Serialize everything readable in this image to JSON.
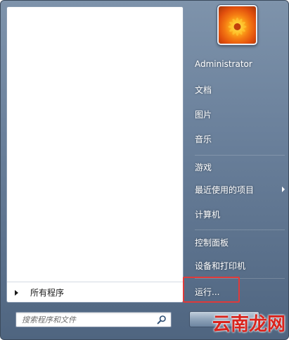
{
  "left_pane": {
    "all_programs_label": "所有程序",
    "search": {
      "placeholder": "搜索程序和文件"
    }
  },
  "right_pane": {
    "user_name": "Administrator",
    "items": [
      {
        "label": "文档"
      },
      {
        "label": "图片"
      },
      {
        "label": "音乐"
      },
      {
        "label": "游戏"
      },
      {
        "label": "最近使用的项目"
      },
      {
        "label": "计算机"
      },
      {
        "label": "控制面板"
      },
      {
        "label": "设备和打印机"
      },
      {
        "label": "运行..."
      }
    ]
  },
  "watermark": {
    "text": "云南龙网"
  },
  "colors": {
    "highlight_border": "#e03a3a",
    "watermark": "#d9241d"
  }
}
